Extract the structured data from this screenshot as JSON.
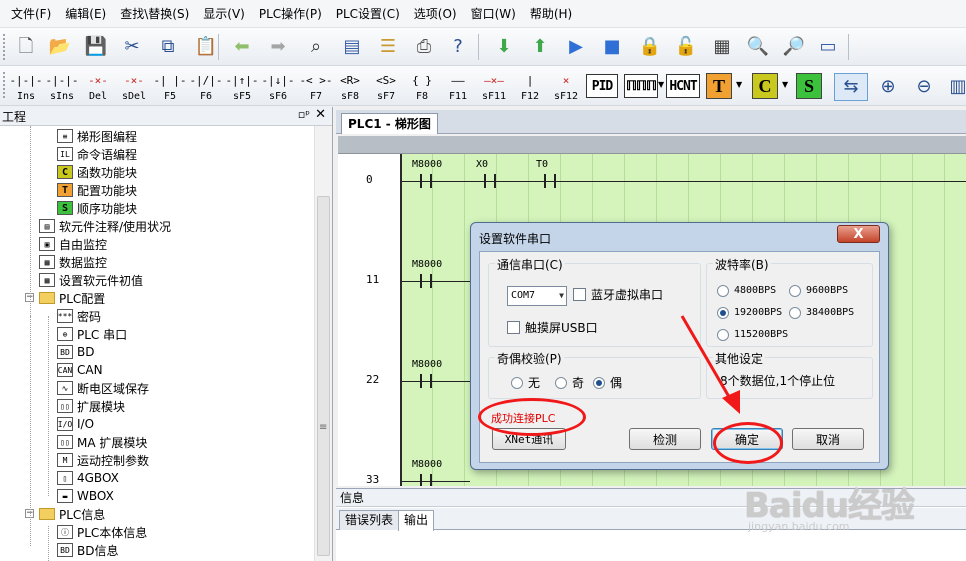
{
  "menu": [
    "文件(F)",
    "编辑(E)",
    "查找\\替换(S)",
    "显示(V)",
    "PLC操作(P)",
    "PLC设置(C)",
    "选项(O)",
    "窗口(W)",
    "帮助(H)"
  ],
  "toolbar1_icons": [
    {
      "name": "new-file-icon",
      "glyph": "🗋",
      "color": "#ffffff"
    },
    {
      "name": "open-folder-icon",
      "glyph": "📂",
      "color": "#f2c14e"
    },
    {
      "name": "save-icon",
      "glyph": "💾",
      "color": "#3a5fa8"
    },
    {
      "name": "cut-icon",
      "glyph": "✂",
      "color": "#2a4f8f"
    },
    {
      "name": "copy-icon",
      "glyph": "⧉",
      "color": "#2a4f8f"
    },
    {
      "name": "paste-icon",
      "glyph": "📋",
      "color": "#c99a2e"
    },
    {
      "name": "back-arrow-icon",
      "glyph": "⬅",
      "color": "#8fbf6a"
    },
    {
      "name": "forward-arrow-icon",
      "glyph": "➡",
      "color": "#a5a5a5"
    },
    {
      "name": "find-binoculars-icon",
      "glyph": "⌕",
      "color": "#333333"
    },
    {
      "name": "window-icon",
      "glyph": "▤",
      "color": "#3a5fa8"
    },
    {
      "name": "list-icon",
      "glyph": "☰",
      "color": "#c99a2e"
    },
    {
      "name": "print-icon",
      "glyph": "⎙",
      "color": "#555555"
    },
    {
      "name": "help-icon",
      "glyph": "?",
      "color": "#2a4f8f"
    },
    {
      "name": "download-icon",
      "glyph": "⬇",
      "color": "#3fa84a"
    },
    {
      "name": "upload-icon",
      "glyph": "⬆",
      "color": "#3fa84a"
    },
    {
      "name": "run-icon",
      "glyph": "▶",
      "color": "#2f6fd6"
    },
    {
      "name": "stop-icon",
      "glyph": "■",
      "color": "#2f6fd6"
    },
    {
      "name": "lock-icon",
      "glyph": "🔒",
      "color": "#d8a21d"
    },
    {
      "name": "unlock-icon",
      "glyph": "🔓",
      "color": "#d8a21d"
    },
    {
      "name": "film-icon",
      "glyph": "▦",
      "color": "#444444"
    },
    {
      "name": "zoom-grid-icon",
      "glyph": "🔍",
      "color": "#555555"
    },
    {
      "name": "zoom-doc-icon",
      "glyph": "🔎",
      "color": "#555555"
    },
    {
      "name": "serial-port-icon",
      "glyph": "▭",
      "color": "#3a5fa8"
    }
  ],
  "toolbar2": {
    "ladder_buttons": [
      {
        "sym": "-|-|-",
        "label": "Ins"
      },
      {
        "sym": "-|-|-",
        "label": "sIns"
      },
      {
        "sym": "-×-",
        "label": "Del"
      },
      {
        "sym": "-×-",
        "label": "sDel"
      },
      {
        "sym": "-| |-",
        "label": "F5"
      },
      {
        "sym": "-|/|-",
        "label": "F6"
      },
      {
        "sym": "-|↑|-",
        "label": "sF5"
      },
      {
        "sym": "-|↓|-",
        "label": "sF6"
      },
      {
        "sym": "-< >-",
        "label": "F7"
      },
      {
        "sym": "<R>",
        "label": "sF8"
      },
      {
        "sym": "<S>",
        "label": "sF7"
      },
      {
        "sym": "{ }",
        "label": "F8"
      },
      {
        "sym": "——",
        "label": "F11"
      },
      {
        "sym": "—×—",
        "label": "sF11"
      },
      {
        "sym": "|",
        "label": "F12"
      },
      {
        "sym": "×",
        "label": "sF12"
      }
    ],
    "boxes": [
      "PID",
      "ℿℿℿ",
      "HCNT"
    ],
    "colored": [
      {
        "letter": "T",
        "color": "#f0a132"
      },
      {
        "letter": "C",
        "color": "#c8c81e"
      },
      {
        "letter": "S",
        "color": "#3cc13c"
      }
    ]
  },
  "left_panel": {
    "title": "工程",
    "pin": "📌",
    "close": "✕",
    "tree": [
      {
        "label": "梯形图编程",
        "icon": "≡",
        "level": 2,
        "icontype": "plain"
      },
      {
        "label": "命令语编程",
        "icon": "IL",
        "level": 2,
        "icontype": "plain"
      },
      {
        "label": "函数功能块",
        "icon": "C",
        "level": 2,
        "icontype": "colored",
        "color": "#c8c81e"
      },
      {
        "label": "配置功能块",
        "icon": "T",
        "level": 2,
        "icontype": "colored",
        "color": "#f0a132"
      },
      {
        "label": "顺序功能块",
        "icon": "S",
        "level": 2,
        "icontype": "colored",
        "color": "#3cc13c"
      },
      {
        "label": "软元件注释/使用状况",
        "icon": "▤",
        "level": 1,
        "icontype": "plain"
      },
      {
        "label": "自由监控",
        "icon": "▣",
        "level": 1,
        "icontype": "plain"
      },
      {
        "label": "数据监控",
        "icon": "▦",
        "level": 1,
        "icontype": "plain"
      },
      {
        "label": "设置软元件初值",
        "icon": "▦",
        "level": 1,
        "icontype": "plain"
      },
      {
        "label": "PLC配置",
        "icon": "",
        "level": 1,
        "icontype": "folder",
        "toggle": "−"
      },
      {
        "label": "密码",
        "icon": "***",
        "level": 2,
        "icontype": "plain"
      },
      {
        "label": "PLC 串口",
        "icon": "⊕",
        "level": 2,
        "icontype": "plain"
      },
      {
        "label": "BD",
        "icon": "BD",
        "level": 2,
        "icontype": "plain"
      },
      {
        "label": "CAN",
        "icon": "CAN",
        "level": 2,
        "icontype": "plain"
      },
      {
        "label": "断电区域保存",
        "icon": "∿",
        "level": 2,
        "icontype": "plain"
      },
      {
        "label": "扩展模块",
        "icon": "▯▯",
        "level": 2,
        "icontype": "plain"
      },
      {
        "label": "I/O",
        "icon": "I/O",
        "level": 2,
        "icontype": "plain"
      },
      {
        "label": "MA 扩展模块",
        "icon": "▯▯",
        "level": 2,
        "icontype": "plain"
      },
      {
        "label": "运动控制参数",
        "icon": "M",
        "level": 2,
        "icontype": "plain"
      },
      {
        "label": "4GBOX",
        "icon": "▯",
        "level": 2,
        "icontype": "plain"
      },
      {
        "label": "WBOX",
        "icon": "▬",
        "level": 2,
        "icontype": "plain"
      },
      {
        "label": "PLC信息",
        "icon": "",
        "level": 1,
        "icontype": "folder",
        "toggle": "−"
      },
      {
        "label": "PLC本体信息",
        "icon": "ⓘ",
        "level": 2,
        "icontype": "plain"
      },
      {
        "label": "BD信息",
        "icon": "BD",
        "level": 2,
        "icontype": "plain"
      }
    ]
  },
  "doc_tab": "PLC1 - 梯形图",
  "ladder": {
    "rungs": [
      "0",
      "11",
      "22",
      "33"
    ],
    "contacts": [
      {
        "label": "M8000",
        "rung": 0,
        "col": 0
      },
      {
        "label": "X0",
        "rung": 0,
        "col": 1
      },
      {
        "label": "T0",
        "rung": 0,
        "col": 2
      },
      {
        "label": "M8000",
        "rung": 1,
        "col": 0
      },
      {
        "label": "M8000",
        "rung": 2,
        "col": 0
      },
      {
        "label": "M8000",
        "rung": 3,
        "col": 0
      }
    ]
  },
  "info_pane": {
    "title": "信息",
    "tabs": [
      "错误列表",
      "输出"
    ],
    "active_tab": 1
  },
  "dialog": {
    "title": "设置软件串口",
    "close_label": "X",
    "comm_group": {
      "title": "通信串口(C)",
      "port_value": "COM7",
      "bluetooth_label": "蓝牙虚拟串口",
      "touchscreen_label": "触摸屏USB口"
    },
    "baud_group": {
      "title": "波特率(B)",
      "options": [
        "4800BPS",
        "9600BPS",
        "19200BPS",
        "38400BPS",
        "115200BPS"
      ],
      "selected": "19200BPS"
    },
    "parity_group": {
      "title": "奇偶校验(P)",
      "options": [
        "无",
        "奇",
        "偶"
      ],
      "selected": "偶"
    },
    "other_group": {
      "title": "其他设定",
      "text": "8个数据位,1个停止位"
    },
    "status": "成功连接PLC",
    "buttons": {
      "xnet": "XNet通讯",
      "detect": "检测",
      "ok": "确定",
      "cancel": "取消"
    }
  },
  "annotation_color": "#f01818",
  "watermark": {
    "logo": "Baidu经验",
    "url": "jingyan.baidu.com"
  }
}
